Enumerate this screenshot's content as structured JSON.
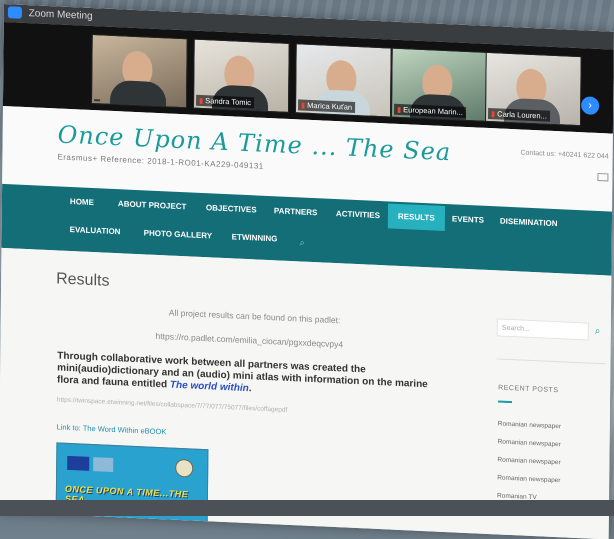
{
  "window": {
    "title": "Zoom Meeting"
  },
  "gallery": {
    "participants": [
      {
        "name": ""
      },
      {
        "name": "Sandra Tomic"
      },
      {
        "name": "Marica Kuťan"
      },
      {
        "name": "European Marin..."
      },
      {
        "name": "Carla Louren..."
      }
    ],
    "next_icon": "chevron-right-icon"
  },
  "site": {
    "logo": "Once Upon A Time ... The Sea",
    "reference": "Erasmus+ Reference: 2018-1-RO01-KA229-049131",
    "contact": "Contact us: +40241 622 044",
    "nav": [
      "HOME",
      "ABOUT PROJECT",
      "OBJECTIVES",
      "PARTNERS",
      "ACTIVITIES",
      "RESULTS",
      "EVENTS",
      "DISEMINATION",
      "EVALUATION",
      "PHOTO GALLERY",
      "ETWINNING"
    ],
    "active_nav": "RESULTS"
  },
  "content": {
    "title": "Results",
    "intro": "All project results can be found on this padlet:",
    "padlet_url": "https://ro.padlet.com/emilia_ciocan/pgxxdeqcvpy4",
    "body_before": "Through collaborative work between all partners was created the mini(audio)dictionary and an (audio) mini atlas with information on the marine flora and fauna entitled ",
    "body_em": "The world within",
    "body_after": ".",
    "twinspace_url": "https://twinspace.etwinning.net/files/collabspace/7/77/077/75077/files/coffagepdf",
    "ebook_link": "Link to: The Word Within eBOOK",
    "ebook_title": "ONCE UPON A TIME...THE SEA"
  },
  "sidebar": {
    "search_placeholder": "Search...",
    "recent_title": "RECENT POSTS",
    "posts": [
      "Romanian newspaper",
      "Romanian newspaper",
      "Romanian newspaper",
      "Romanian newspaper",
      "Romanian TV"
    ]
  },
  "colors": {
    "teal_nav": "#136e77",
    "accent": "#27b0bd",
    "logo": "#1a9a9a"
  }
}
